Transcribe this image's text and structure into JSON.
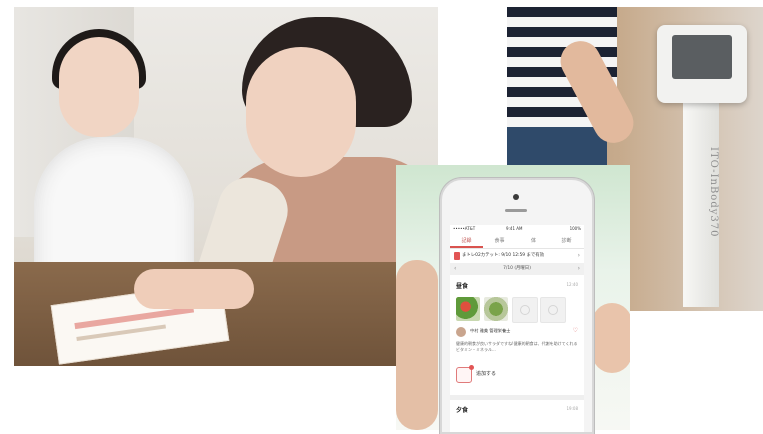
{
  "photos": {
    "consult": {
      "desc_name": "consultation"
    },
    "scale": {
      "brand_label": "ITO-InBody370"
    }
  },
  "app": {
    "status": {
      "carrier": "•••••AT&T",
      "time": "9:41 AM",
      "battery": "100%"
    },
    "tabs": [
      {
        "label": "記録",
        "active": true
      },
      {
        "label": "食事",
        "active": false
      },
      {
        "label": "体",
        "active": false
      },
      {
        "label": "診断",
        "active": false
      }
    ],
    "ticket": {
      "text": "まトレ02カテット: 9/10 12:59 まで有効"
    },
    "date": {
      "label": "7/10 (月曜日)"
    },
    "meals": [
      {
        "title": "昼食",
        "time": "12:40"
      },
      {
        "title": "夕食",
        "time": "19:08"
      }
    ],
    "comment": {
      "name": "中村 雅美  管理栄養士",
      "body": "健康的朝食が良いサラダですね!健康的朝食は、代謝を助けてくれるビタミン・ミネラル..."
    },
    "add_label": "追加する"
  },
  "colors": {
    "accent": "#d9534f"
  }
}
